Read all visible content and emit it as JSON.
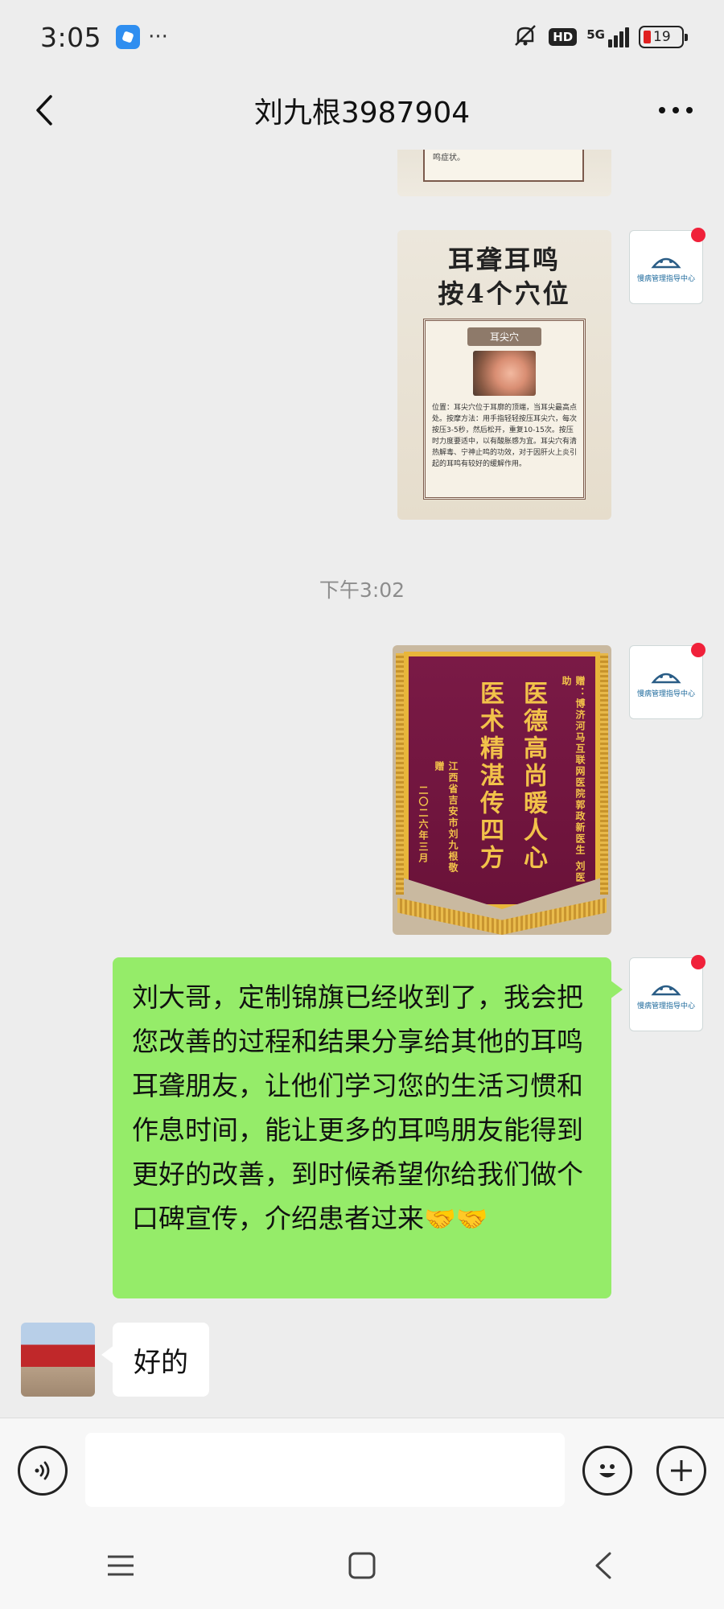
{
  "status_bar": {
    "time": "3:05",
    "more": "···",
    "hd": "HD",
    "network": "5G",
    "battery": "19"
  },
  "nav": {
    "title": "刘九根3987904"
  },
  "messages": {
    "image1_text": "摩此穴可以促进耳部气血流通，缓解耳鸣症状。",
    "image2": {
      "title_line1": "耳聋耳鸣",
      "title_line2": "按4个穴位",
      "point_label": "耳尖穴",
      "desc": "位置：耳尖穴位于耳廓的顶端，当耳尖最高点处。按摩方法：用手指轻轻按压耳尖穴，每次按压3-5秒，然后松开，重复10-15次。按压时力度要适中，以有酸胀感为宜。耳尖穴有清热解毒、宁神止鸣的功效，对于因肝火上炎引起的耳鸣有较好的缓解作用。"
    },
    "timestamp": "下午3:02",
    "banner": {
      "main_right": "医德高尚暖人心",
      "main_left": "医术精湛传四方",
      "recipient": "赠：博济河马互联网医院郭政新医生 刘医助",
      "sender": "江西省吉安市刘九根敬赠",
      "date": "二〇二六年三月"
    },
    "outgoing_text": "刘大哥，定制锦旗已经收到了，我会把您改善的过程和结果分享给其他的耳鸣耳聋朋友，让他们学习您的生活习惯和作息时间，能让更多的耳鸣朋友能得到更好的改善，到时候希望你给我们做个口碑宣传，介绍患者过来",
    "outgoing_emoji": "🤝🤝",
    "incoming_text": "好的",
    "self_avatar_text": "慢病管理指导中心"
  },
  "input": {
    "placeholder": ""
  },
  "colors": {
    "chat_bg": "#ededed",
    "outgoing_bubble": "#95ec69",
    "incoming_bubble": "#ffffff",
    "badge_red": "#f0213a"
  },
  "icons": [
    "back-arrow-icon",
    "more-icon",
    "voice-icon",
    "emoji-icon",
    "plus-icon",
    "menu-icon",
    "home-icon",
    "back-icon"
  ]
}
